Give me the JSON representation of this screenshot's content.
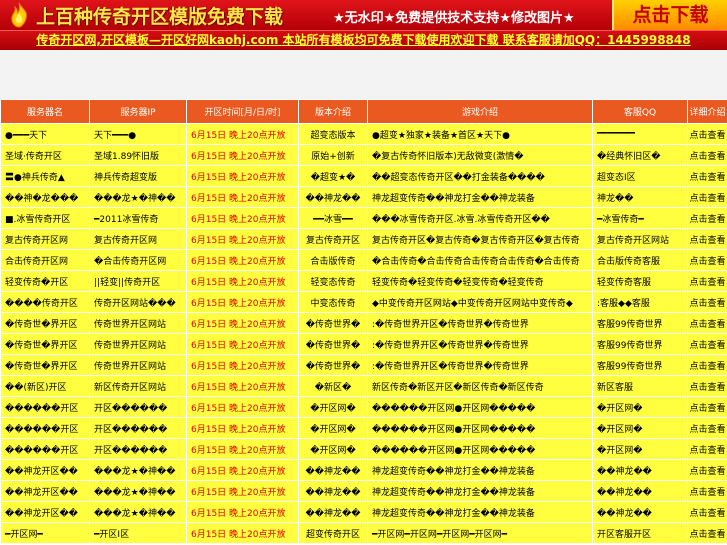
{
  "banner": {
    "title": "上百种传奇开区模版免费下载",
    "features": "★无水印★免费提供技术支持★修改图片★",
    "download_label": "点击下载"
  },
  "contact": {
    "text": "传奇开区网,开区模板—开区好网kaohj.com 本站所有模板均可免费下载使用欢迎下载 联系客服请加QQ：1445998848"
  },
  "table": {
    "headers": [
      "服务器名",
      "服务器IP",
      "开区时间[月/日/时]",
      "版本介绍",
      "游戏介绍",
      "客服QQ",
      "详细介绍"
    ],
    "rows": [
      [
        "●━━━天下",
        "天下━━━●",
        "6月15日 晚上20点开放",
        "超变态版本",
        "●超变★独家★装备★首区★天下●",
        "━━━━━━━",
        "点击查看"
      ],
      [
        "圣域·传奇开区",
        "圣域1.89怀旧版",
        "6月15日 晚上20点开放",
        "原始+创新",
        "�复古传奇怀旧版本)无敌微变(激情�",
        "�经典怀旧区�",
        "点击查看"
      ],
      [
        "〓●神兵传奇▲",
        "神兵传奇超变版",
        "6月15日 晚上20点开放",
        "�超变★�",
        "��超变态传奇开区��打金装备����",
        "超变态Ⅰ区",
        "点击查看"
      ],
      [
        "��神�龙���",
        "���龙★�神��",
        "6月15日 晚上20点开放",
        "��神龙��",
        "神龙超变传奇��神龙打金��神龙装备",
        "神龙��",
        "点击查看"
      ],
      [
        "■.冰雪传奇开区",
        "━2011冰雪传奇",
        "6月15日 晚上20点开放",
        "━━冰雪━━",
        "���冰雪传奇开区.冰雪.冰雪传奇开区��",
        "━冰雪传奇━",
        "点击查看"
      ],
      [
        "复古传奇开区网",
        "复古传奇开区网",
        "6月15日 晚上20点开放",
        "复古传奇开区",
        "复古传奇开区�复古传奇�复古传奇开区�复古传奇",
        "复古传奇开区网站",
        "点击查看"
      ],
      [
        "合击传奇开区网",
        "�合击传奇开区网",
        "6月15日 晚上20点开放",
        "合击版传奇",
        "�合击传奇�合击传奇合击传奇合击传奇�合击传奇",
        "合击版传奇客服",
        "点击查看"
      ],
      [
        "轻变传奇�开区",
        "||轻变||传奇开区",
        "6月15日 晚上20点开放",
        "轻变态传奇",
        "轻变传奇�轻变传奇�轻变传奇�轻变传奇",
        "轻变传奇客服",
        "点击查看"
      ],
      [
        "����传奇开区",
        "传奇开区网站���",
        "6月15日 晚上20点开放",
        "中变态传奇",
        "◆中变传奇开区网站◆中变传奇开区网站中变传奇◆",
        ":客服◆◆客服",
        "点击查看"
      ],
      [
        "�传奇世�界开区",
        "传奇世界开区网站",
        "6月15日 晚上20点开放",
        "�传奇世界�",
        ":�传奇世界开区�传奇世界�传奇世界",
        "客服99传奇世界",
        "点击查看"
      ],
      [
        "�传奇世�界开区",
        "传奇世界开区网站",
        "6月15日 晚上20点开放",
        "�传奇世界�",
        ":�传奇世界开区�传奇世界�传奇世界",
        "客服99传奇世界",
        "点击查看"
      ],
      [
        "�传奇世�界开区",
        "传奇世界开区网站",
        "6月15日 晚上20点开放",
        "�传奇世界�",
        ":�传奇世界开区�传奇世界�传奇世界",
        "客服99传奇世界",
        "点击查看"
      ],
      [
        "��(新区)开区",
        "新区传奇开区网站",
        "6月15日 晚上20点开放",
        "�新区�",
        "新区传奇�新区开区�新区传奇�新区传奇",
        "新区客服",
        "点击查看"
      ],
      [
        "������开区",
        "开区������",
        "6月15日 晚上20点开放",
        "�开区网�",
        "������开区网●开区网�����",
        "�开区网�",
        "点击查看"
      ],
      [
        "������开区",
        "开区������",
        "6月15日 晚上20点开放",
        "�开区网�",
        "������开区网●开区网�����",
        "�开区网�",
        "点击查看"
      ],
      [
        "������开区",
        "开区������",
        "6月15日 晚上20点开放",
        "�开区网�",
        "������开区网●开区网�����",
        "�开区网�",
        "点击查看"
      ],
      [
        "��神龙开区��",
        "���龙★�神��",
        "6月15日 晚上20点开放",
        "��神龙��",
        "神龙超变传奇��神龙打金��神龙装备",
        "��神龙��",
        "点击查看"
      ],
      [
        "��神龙开区��",
        "���龙★�神��",
        "6月15日 晚上20点开放",
        "��神龙��",
        "神龙超变传奇��神龙打金��神龙装备",
        "��神龙��",
        "点击查看"
      ],
      [
        "��神龙开区��",
        "���龙★�神��",
        "6月15日 晚上20点开放",
        "��神龙��",
        "神龙超变传奇��神龙打金��神龙装备",
        "��神龙��",
        "点击查看"
      ],
      [
        "━开区网━",
        "━开区Ⅰ区",
        "6月15日 晚上20点开放",
        "超变传奇开区",
        "━开区网━开区网━开区网━开区网━",
        "开区客服开区",
        "点击查看"
      ]
    ]
  }
}
